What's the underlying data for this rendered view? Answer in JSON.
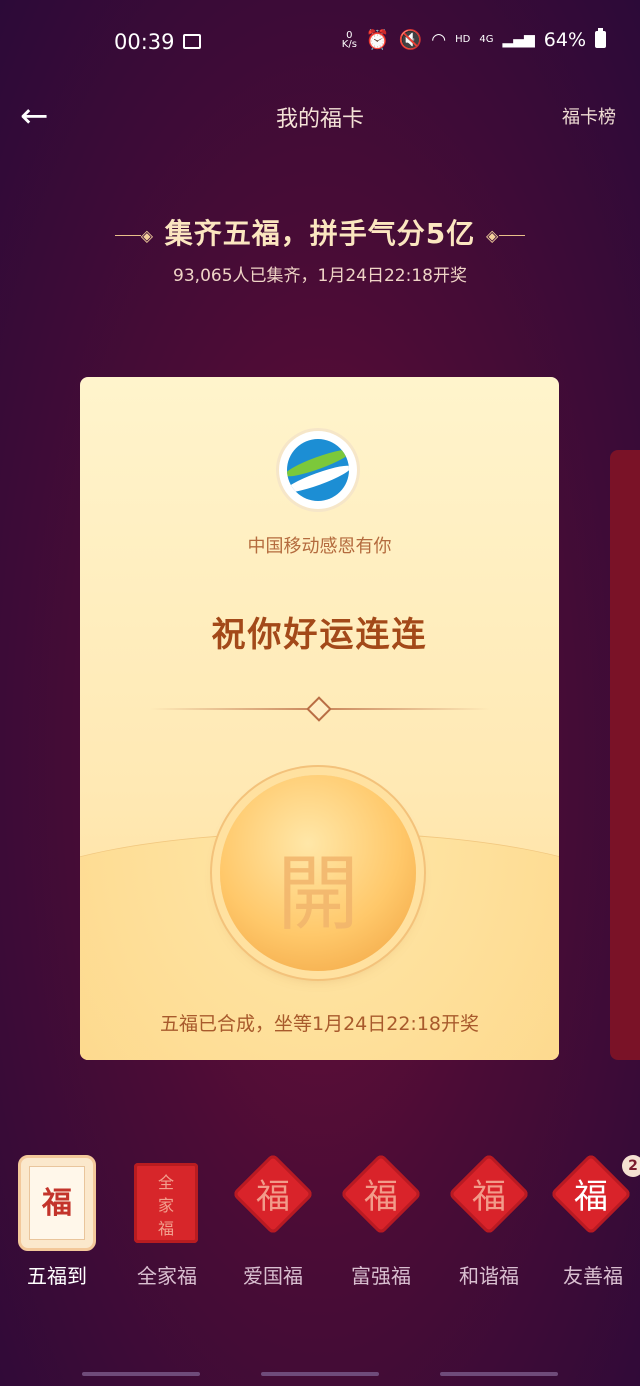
{
  "status_bar": {
    "time": "00:39",
    "net_speed_top": "0",
    "net_speed_unit": "K/s",
    "hd_label": "HD",
    "network_label": "4G",
    "battery": "64%"
  },
  "nav": {
    "title": "我的福卡",
    "right_link": "福卡榜"
  },
  "header": {
    "headline": "集齐五福，拼手气分5亿",
    "subline": "93,065人已集齐，1月24日22:18开奖"
  },
  "card": {
    "brand": "中国移动感恩有你",
    "wish": "祝你好运连连",
    "button_char": "開",
    "note": "五福已合成，坐等1月24日22:18开奖"
  },
  "fu_cards": [
    {
      "label": "五福到",
      "glyph": "福"
    },
    {
      "label": "全家福",
      "glyph_lines": [
        "全",
        "家",
        "福"
      ]
    },
    {
      "label": "爱国福",
      "glyph": "福"
    },
    {
      "label": "富强福",
      "glyph": "福"
    },
    {
      "label": "和谐福",
      "glyph": "福"
    },
    {
      "label": "友善福",
      "glyph": "福",
      "badge": "2"
    }
  ]
}
